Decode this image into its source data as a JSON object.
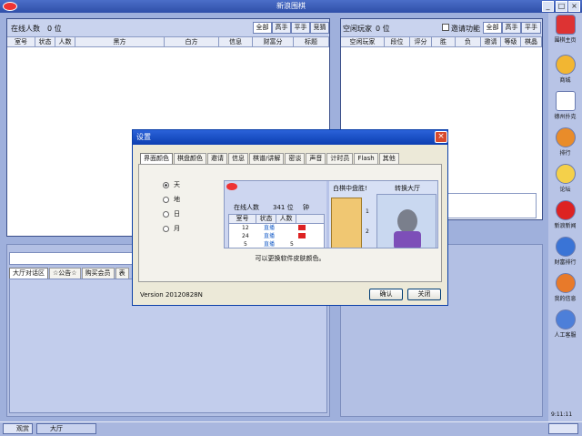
{
  "app": {
    "title": "新浪围棋"
  },
  "left_panel": {
    "online_label": "在线人数",
    "online_count": "0 位",
    "filters": [
      "全部",
      "高手",
      "平手",
      "竞猜"
    ],
    "columns": [
      "室号",
      "状态",
      "人数",
      "黑方",
      "白方",
      "信息",
      "财富分",
      "标题"
    ]
  },
  "right_panel": {
    "title": "空闲玩家",
    "count": "0 位",
    "invite_label": "邀请功能",
    "filters": [
      "全部",
      "高手",
      "平手"
    ],
    "columns": [
      "空闲玩家",
      "段位",
      "评分",
      "胜",
      "负",
      "邀请",
      "等级",
      "棋晶"
    ]
  },
  "chat": {
    "tabs": [
      "大厅对话区",
      "☆公告☆",
      "购买会员",
      "表"
    ]
  },
  "sidebar": {
    "items": [
      "围棋主页",
      "商城",
      "德州扑克",
      "排行",
      "论坛",
      "新浪新闻",
      "财富排行",
      "我的信息",
      "人工客服"
    ],
    "clock": "9:11:11"
  },
  "taskbar": {
    "items": [
      "观赏",
      "大厅"
    ]
  },
  "dialog": {
    "title": "设置",
    "tabs": [
      "界面颜色",
      "棋盘颜色",
      "邀请",
      "信息",
      "棋谱/讲解",
      "密谈",
      "声音",
      "计时员",
      "Flash",
      "其他"
    ],
    "options": [
      "天",
      "地",
      "日",
      "月"
    ],
    "selected_option": "天",
    "hint": "可以更换软件皮肤颜色。",
    "version": "Version 20120828N",
    "ok": "确认",
    "close": "关闭",
    "preview": {
      "online_label": "在线人数",
      "online_count": "341 位",
      "extra": "钟",
      "cols": [
        "室号",
        "状态",
        "人数"
      ],
      "rows": [
        {
          "room": "12",
          "status": "直播"
        },
        {
          "room": "24",
          "status": "直播"
        },
        {
          "room": "5",
          "status": "直播",
          "count": "5"
        }
      ],
      "board_title": "白棋中盘胜!",
      "side_title": "转换大厅",
      "coords": [
        "1",
        "2"
      ]
    }
  }
}
